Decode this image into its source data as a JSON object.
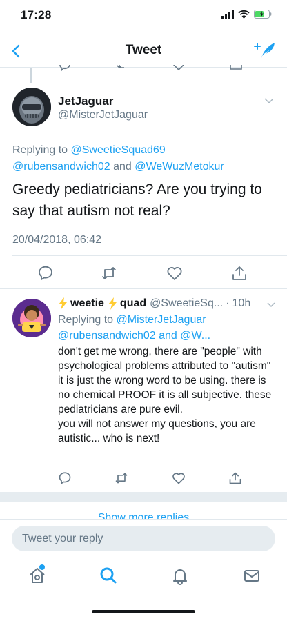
{
  "status_bar": {
    "time": "17:28"
  },
  "nav": {
    "title": "Tweet"
  },
  "main_tweet": {
    "display_name": "JetJaguar",
    "handle": "@MisterJetJaguar",
    "replying_prefix": "Replying to",
    "replying_to": [
      "@SweetieSquad69",
      "@rubensandwich02",
      "@WeWuzMetokur"
    ],
    "replying_and": "and",
    "text": "Greedy pediatricians? Are you trying to say that autism not real?",
    "timestamp": "20/04/2018, 06:42"
  },
  "reply_tweet": {
    "display_name_part1": "weetie",
    "display_name_part2": "quad",
    "handle": "@SweetieSq...",
    "separator": "·",
    "time_ago": "10h",
    "replying_prefix": "Replying to",
    "replying_to_1": "@MisterJetJaguar",
    "replying_to_2": "@rubensandwich02",
    "replying_and": "and",
    "replying_to_3": "@W...",
    "text": "don't get me wrong, there are \"people\" with psychological problems attributed to \"autism\" it is just the wrong word to be using. there is no chemical PROOF it is all subjective. these pediatricians are pure evil.\nyou will not answer my questions, you are autistic... who is next!"
  },
  "show_more": "Show more replies",
  "composer": {
    "placeholder": "Tweet your reply"
  },
  "colors": {
    "accent": "#1da1f2",
    "text": "#14171a",
    "secondary": "#657786",
    "divider": "#e1e8ed"
  },
  "icons": {
    "tab_bar": [
      "home-icon",
      "search-icon",
      "notifications-icon",
      "messages-icon"
    ],
    "actions": [
      "reply-icon",
      "retweet-icon",
      "like-icon",
      "share-icon"
    ]
  }
}
